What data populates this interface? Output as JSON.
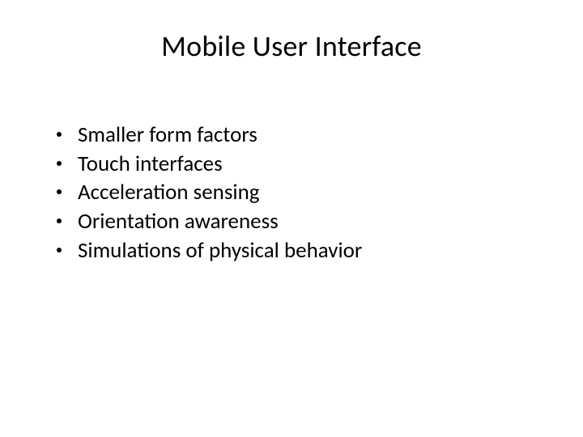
{
  "slide": {
    "title": "Mobile User Interface",
    "bullets": [
      "Smaller form factors",
      "Touch interfaces",
      "Acceleration sensing",
      "Orientation awareness",
      "Simulations of physical behavior"
    ]
  }
}
